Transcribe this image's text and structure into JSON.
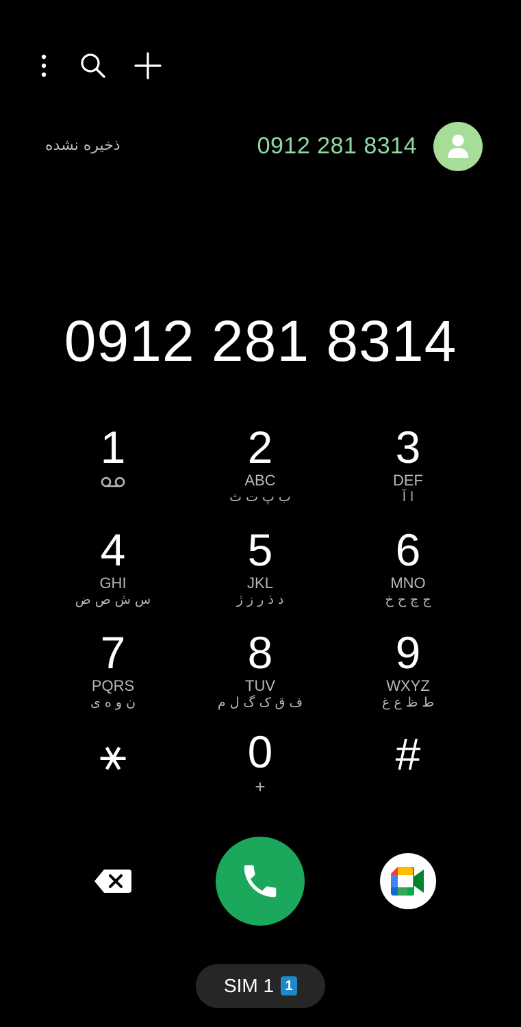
{
  "suggestion": {
    "label": "ذخیره نشده",
    "number": "0912 281 8314"
  },
  "dialed_number": "0912 281 8314",
  "keypad": [
    {
      "digit": "1",
      "letters": "",
      "fa": "",
      "icon": "voicemail-icon"
    },
    {
      "digit": "2",
      "letters": "ABC",
      "fa": "ب پ ت ث"
    },
    {
      "digit": "3",
      "letters": "DEF",
      "fa": "ا آ"
    },
    {
      "digit": "4",
      "letters": "GHI",
      "fa": "س ش ص ض"
    },
    {
      "digit": "5",
      "letters": "JKL",
      "fa": "د ذ ر ز ژ"
    },
    {
      "digit": "6",
      "letters": "MNO",
      "fa": "ج چ ح خ"
    },
    {
      "digit": "7",
      "letters": "PQRS",
      "fa": "ن و ه ی"
    },
    {
      "digit": "8",
      "letters": "TUV",
      "fa": "ف ق ک گ ل م"
    },
    {
      "digit": "9",
      "letters": "WXYZ",
      "fa": "ط ظ ع غ"
    },
    {
      "digit": "⚹",
      "letters": "",
      "fa": ""
    },
    {
      "digit": "0",
      "letters": "+",
      "fa": ""
    },
    {
      "digit": "#",
      "letters": "",
      "fa": ""
    }
  ],
  "sim": {
    "label": "SIM 1",
    "badge": "1"
  },
  "icons": {
    "menu": "more-vert-icon",
    "search": "search-icon",
    "add": "add-icon",
    "avatar": "person-icon",
    "backspace": "backspace-icon",
    "call": "phone-icon",
    "video": "google-meet-icon"
  },
  "colors": {
    "accent_number": "#8fd9a4",
    "avatar_bg": "#a6dd98",
    "call_button": "#1ba85c",
    "sim_badge": "#1e88c8"
  }
}
